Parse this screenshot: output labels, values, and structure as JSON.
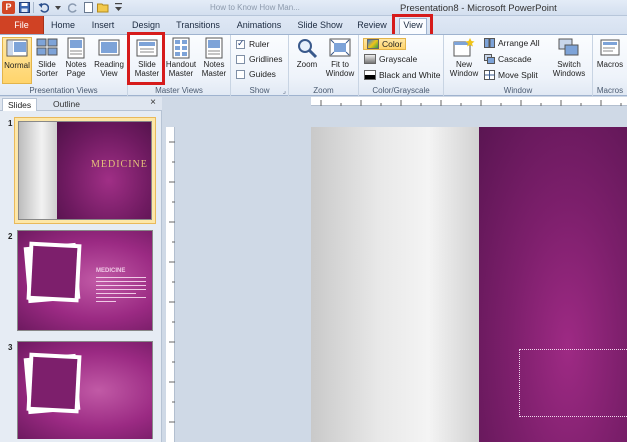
{
  "window": {
    "title": "Presentation8 - Microsoft PowerPoint",
    "faded_title": "How to Know How Man..."
  },
  "qat": {
    "app_icon_letter": "P"
  },
  "tabs": {
    "file": "File",
    "home": "Home",
    "insert": "Insert",
    "design": "Design",
    "transitions": "Transitions",
    "animations": "Animations",
    "slideshow": "Slide Show",
    "review": "Review",
    "view": "View"
  },
  "ribbon": {
    "presentation_views": {
      "label": "Presentation Views",
      "normal": "Normal",
      "slide_sorter": "Slide\nSorter",
      "notes_page": "Notes\nPage",
      "reading_view": "Reading\nView"
    },
    "master_views": {
      "label": "Master Views",
      "slide_master": "Slide\nMaster",
      "handout_master": "Handout\nMaster",
      "notes_master": "Notes\nMaster"
    },
    "show": {
      "label": "Show",
      "ruler": "Ruler",
      "gridlines": "Gridlines",
      "guides": "Guides"
    },
    "zoom": {
      "label": "Zoom",
      "zoom": "Zoom",
      "fit_to_window": "Fit to\nWindow"
    },
    "color": {
      "label": "Color/Grayscale",
      "color": "Color",
      "grayscale": "Grayscale",
      "black_and_white": "Black and White"
    },
    "window": {
      "label": "Window",
      "new_window": "New\nWindow",
      "arrange_all": "Arrange All",
      "cascade": "Cascade",
      "move_split": "Move Split",
      "switch_windows": "Switch\nWindows"
    },
    "macros": {
      "label": "Macros",
      "macros": "Macros"
    }
  },
  "pane": {
    "tab_slides": "Slides",
    "tab_outline": "Outline",
    "close": "×",
    "slides": [
      {
        "num": "1",
        "title": "MEDICINE"
      },
      {
        "num": "2",
        "title": "MEDICINE"
      },
      {
        "num": "3",
        "title": ""
      }
    ]
  },
  "colors": {
    "accent_file_tab": "#d04224",
    "highlight_box": "#d61b1b",
    "slide_purple": "#7d1f6c",
    "selection_gold": "#fde7a8"
  }
}
